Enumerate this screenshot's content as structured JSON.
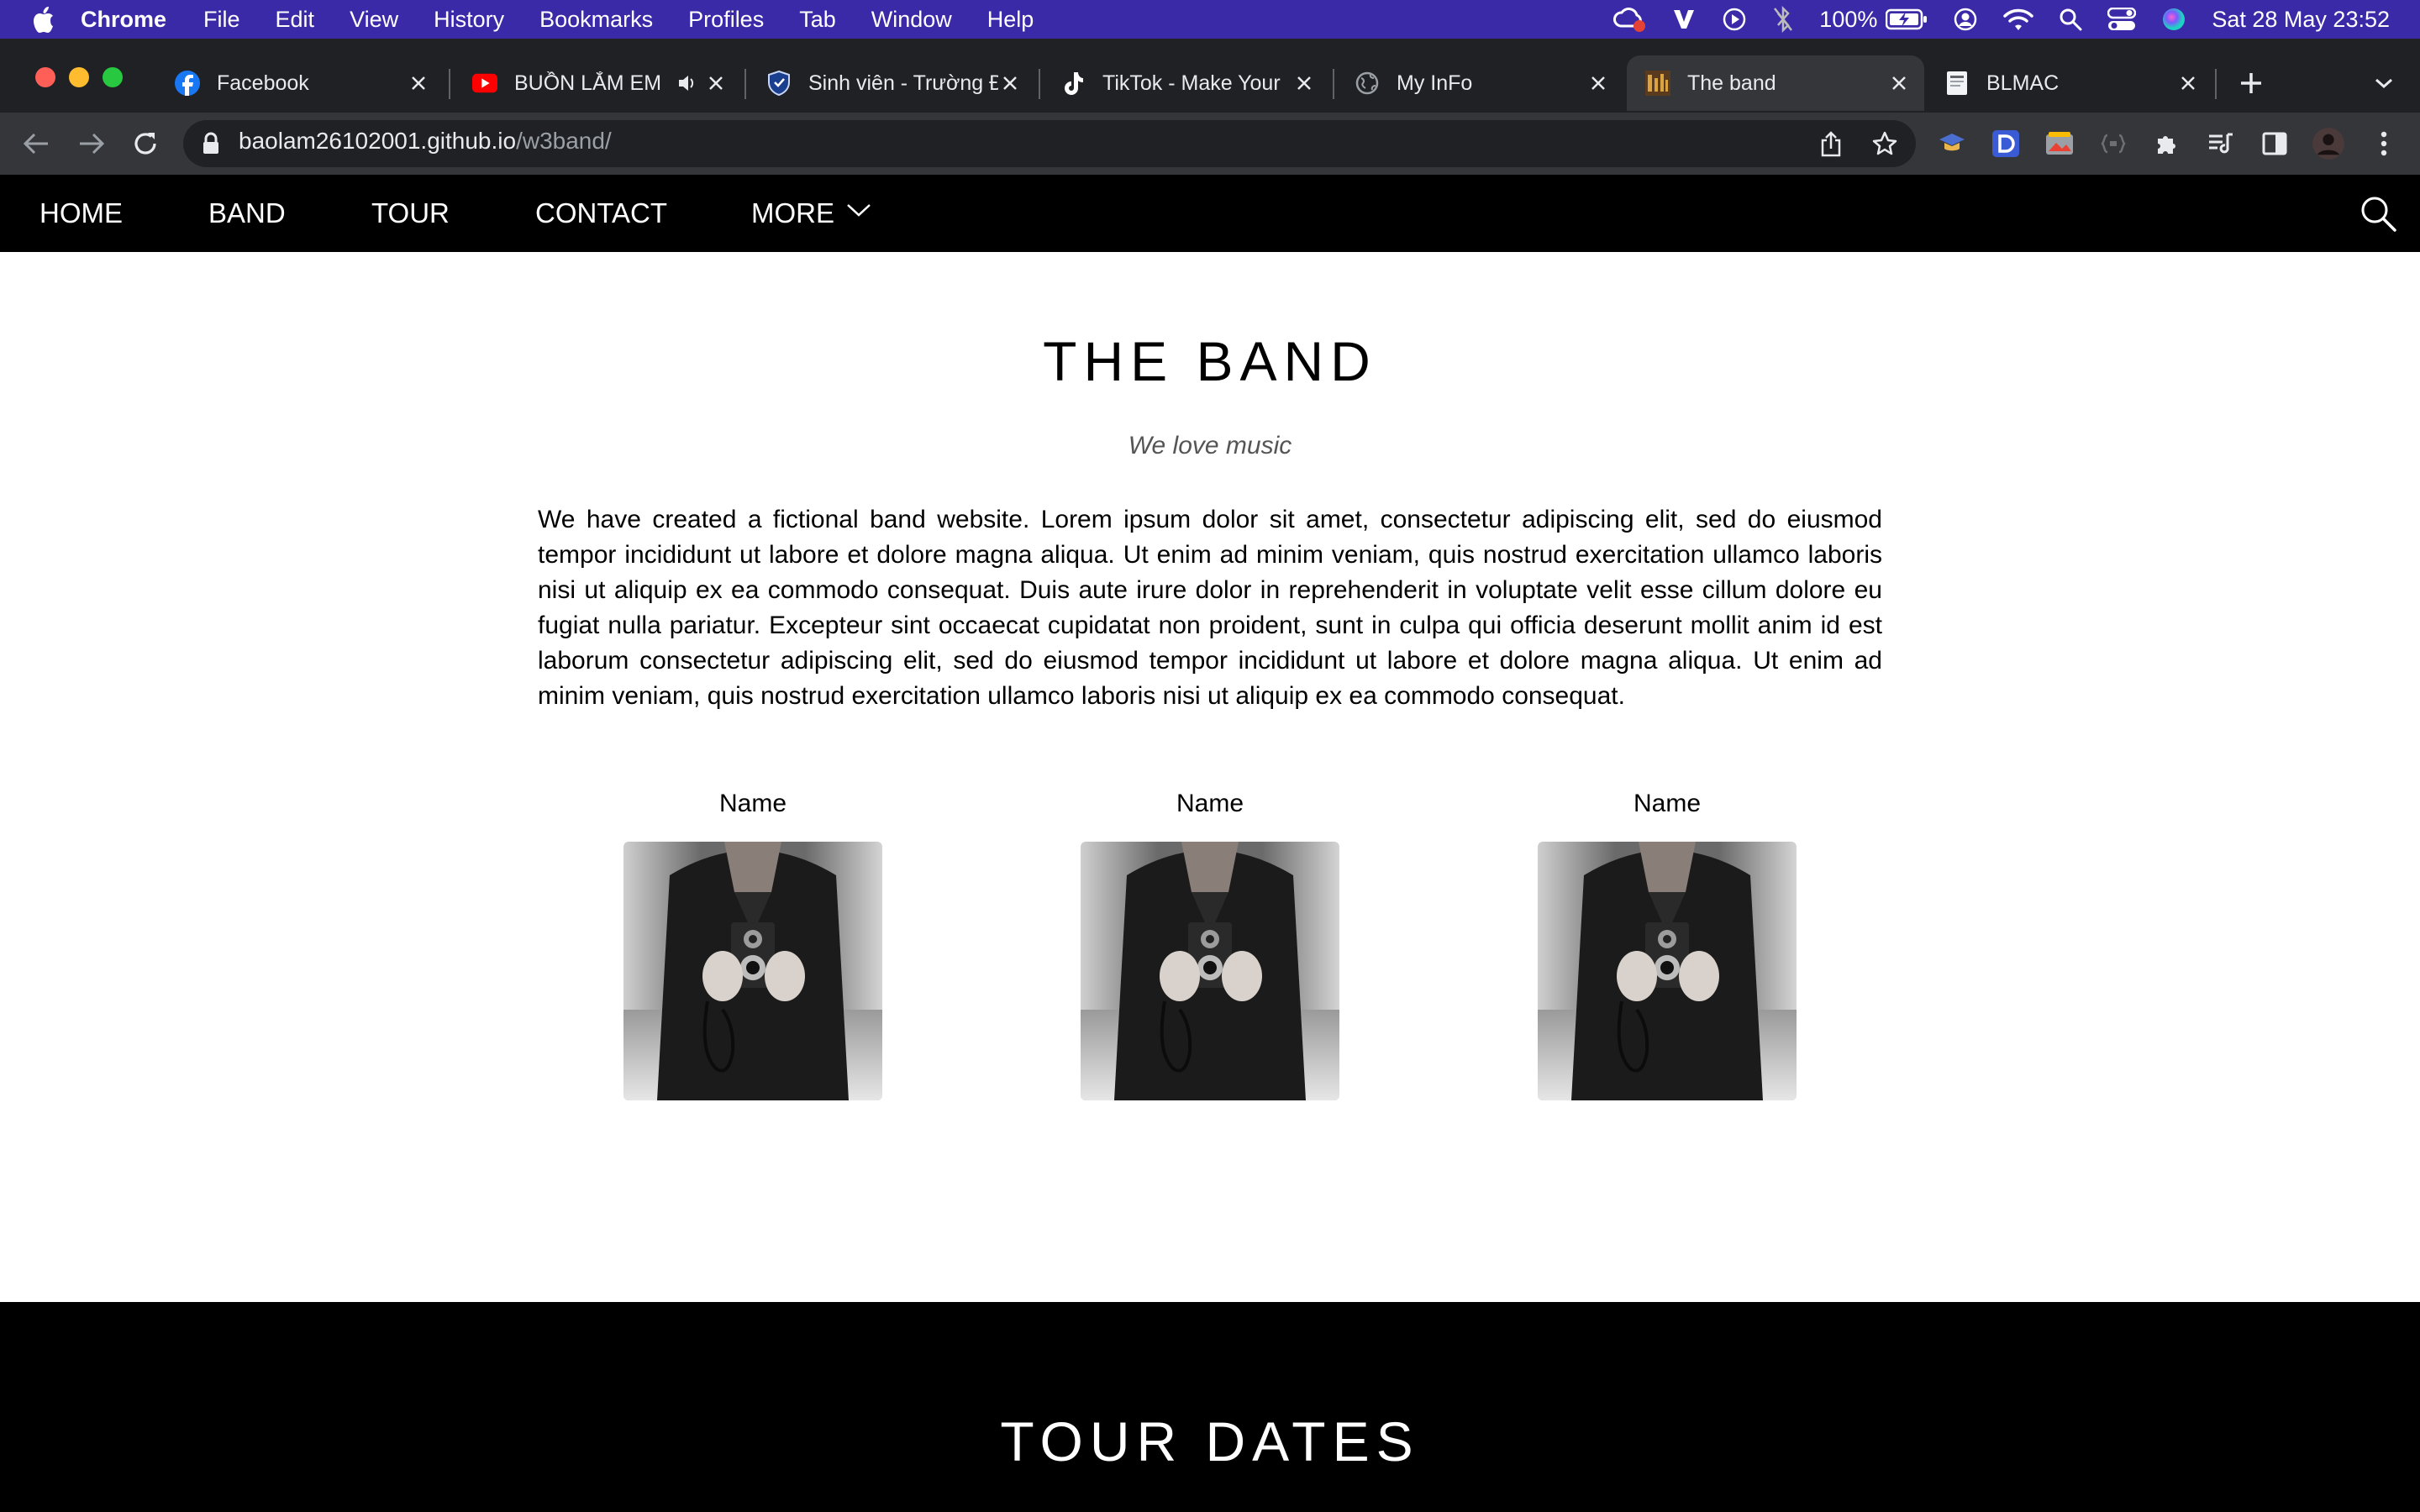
{
  "menubar": {
    "app_name": "Chrome",
    "items": [
      "File",
      "Edit",
      "View",
      "History",
      "Bookmarks",
      "Profiles",
      "Tab",
      "Window",
      "Help"
    ],
    "battery": "100%",
    "datetime": "Sat 28 May  23:52"
  },
  "tabs": [
    {
      "title": "Facebook",
      "icon": "facebook-icon"
    },
    {
      "title": "BUỒN LẮM EM",
      "icon": "youtube-icon"
    },
    {
      "title": "Sinh viên - Trường Đ",
      "icon": "shield-icon"
    },
    {
      "title": "TikTok - Make Your",
      "icon": "tiktok-icon"
    },
    {
      "title": "My InFo",
      "icon": "globe-icon"
    },
    {
      "title": "The band",
      "icon": "band-icon"
    },
    {
      "title": "BLMAC",
      "icon": "document-icon"
    }
  ],
  "address": {
    "host": "baolam26102001.github.io",
    "path": "/w3band/"
  },
  "site": {
    "nav": [
      "HOME",
      "BAND",
      "TOUR",
      "CONTACT",
      "MORE"
    ],
    "band_title": "THE BAND",
    "band_subtitle": "We love music",
    "band_description": "We have created a fictional band website. Lorem ipsum dolor sit amet, consectetur adipiscing elit, sed do eiusmod tempor incididunt ut labore et dolore magna aliqua. Ut enim ad minim veniam, quis nostrud exercitation ullamco laboris nisi ut aliquip ex ea commodo consequat. Duis aute irure dolor in reprehenderit in voluptate velit esse cillum dolore eu fugiat nulla pariatur. Excepteur sint occaecat cupidatat non proident, sunt in culpa qui officia deserunt mollit anim id est laborum consectetur adipiscing elit, sed do eiusmod tempor incididunt ut labore et dolore magna aliqua. Ut enim ad minim veniam, quis nostrud exercitation ullamco laboris nisi ut aliquip ex ea commodo consequat.",
    "members": [
      {
        "name": "Name"
      },
      {
        "name": "Name"
      },
      {
        "name": "Name"
      }
    ],
    "tour_title": "TOUR DATES"
  },
  "colors": {
    "menubar_bg": "#3a2aa8",
    "tabstrip_bg": "#202124",
    "toolbar_bg": "#35363a",
    "nav_bg": "#000000",
    "content_bg": "#ffffff"
  }
}
